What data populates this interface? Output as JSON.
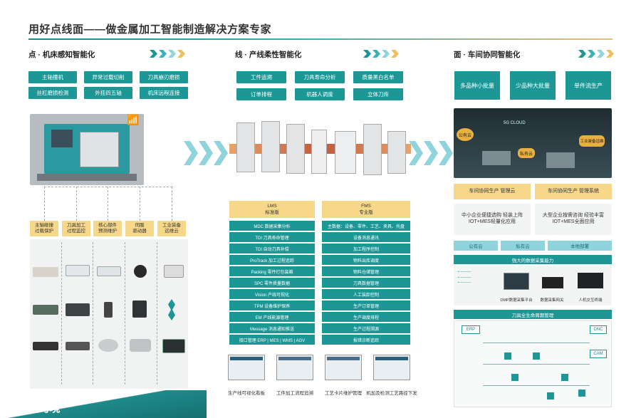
{
  "page": {
    "title": "用好点线面——做金属加工智能制造解决方案专家"
  },
  "colors": {
    "teal": "#1d9696",
    "light_teal": "#8fd3dd",
    "gold": "#f7d78a",
    "gray_bg": "#f1f2f2"
  },
  "col1": {
    "title": "点 · 机床感知智能化",
    "buttons": [
      "主轴撞机",
      "异常过载切削",
      "刀具崩刃磨损",
      "丝杠磨损检测",
      "外挂四五轴",
      "机床远程连接"
    ],
    "labels": [
      "主轴碰撞\n过载保护",
      "刀具加工\n过程监控",
      "核心部件\n预测维护",
      "伺服\n驱动器",
      "工业装备\n远维云"
    ]
  },
  "col2": {
    "title": "线 · 产线柔性智能化",
    "buttons": [
      "工件追溯",
      "刀具寿命分析",
      "质量黑白名单",
      "订单排程",
      "机器人调度",
      "立体刀库"
    ],
    "lms": {
      "head": "LMS\n标准版",
      "rows": [
        "MDC 数据采集分析",
        "TDI 刀具寿命管理",
        "TDI 自动刀具补偿",
        "ProTrack 加工过程追踪",
        "Packing 零件打包装箱",
        "SPC 零件质量数据",
        "Vision 产线可视化",
        "TPM 设备维护保养",
        "EM 产线能源管理",
        "Message 消息通知推送",
        "接口管理 ERP | MES | WMS | AGV"
      ]
    },
    "fms": {
      "head": "FMS\n专业版",
      "rows": [
        "主数据：设备、零件、工艺、夹具、托盘",
        "设备消息通讯",
        "加工程序控制",
        "物料出库调度",
        "物料仓储管理",
        "刀具数据管理",
        "人工装卸控制",
        "生产订单管理",
        "生产调度排程",
        "生产过程溯源",
        "报错诊断追踪"
      ]
    },
    "captions": [
      "生产线可视化看板",
      "工件加工流程追溯",
      "工艺卡片维护管理",
      "机加及检测工艺路径下发"
    ]
  },
  "col3": {
    "title": "面 · 车间协同智能化",
    "buttons": [
      "多品种小批量",
      "少品种大批量",
      "单件流生产"
    ],
    "cloud_tags": [
      "公有云",
      "5G CLOUD",
      "私有云",
      "工业装备远维"
    ],
    "bands": [
      "车间协同生产 管理云",
      "车间协同生产 管理系统"
    ],
    "descs": [
      "中小企业便捷选购 轻装上阵\nIOT+MES轻量化应用",
      "大型企业按需咨询 经验丰富\nIOT+MES全面应用"
    ],
    "deploy": [
      "公有云",
      "私有云",
      "本地部署"
    ],
    "data_title": "强大的数据采集能力",
    "data_items": [
      "DMP数据采集平台",
      "数据采集网关",
      "人机交互终端"
    ],
    "tool_title": "刀具全生命周期管理",
    "tool_tags": [
      "ERP",
      "DNC",
      "CAM"
    ]
  },
  "brand": {
    "name": "大数跨境"
  }
}
